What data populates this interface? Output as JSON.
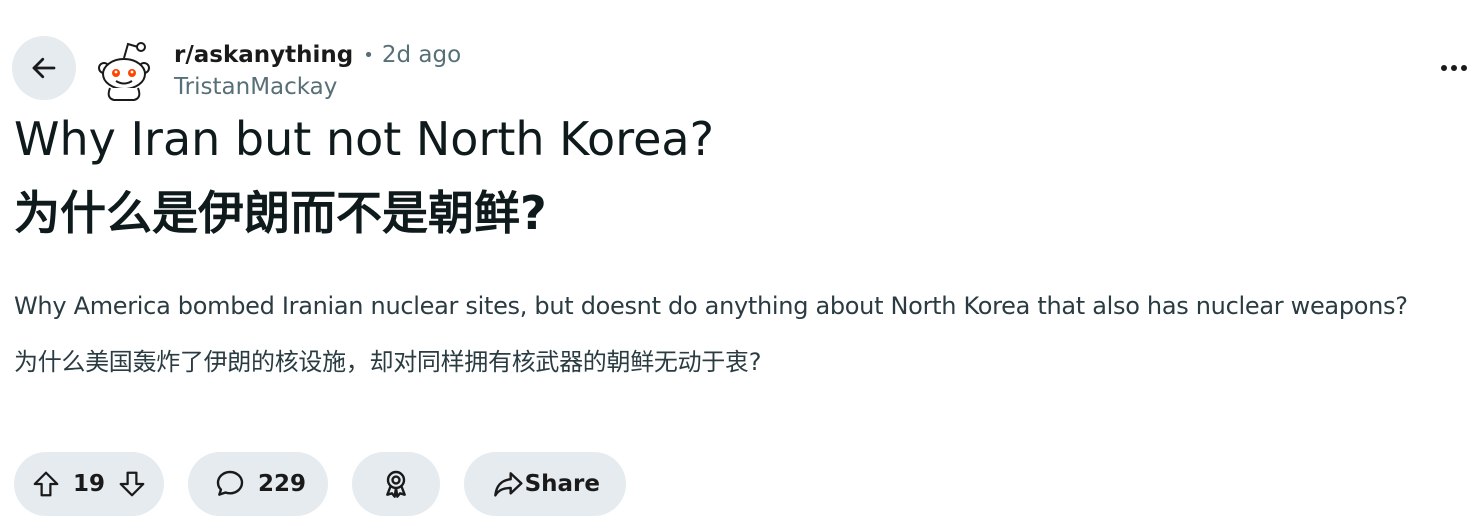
{
  "header": {
    "subreddit": "r/askanything",
    "separator": "•",
    "timestamp": "2d ago",
    "author": "TristanMackay"
  },
  "post": {
    "title_lines": [
      "Why Iran but not North Korea?",
      "为什么是伊朗而不是朝鲜?"
    ],
    "body_lines": [
      "Why America bombed Iranian nuclear sites, but doesnt do anything about North Korea that also has nuclear weapons?",
      "为什么美国轰炸了伊朗的核设施，却对同样拥有核武器的朝鲜无动于衷?"
    ]
  },
  "actions": {
    "vote_count": "19",
    "comment_count": "229",
    "share_label": "Share"
  },
  "icons": {
    "back": "arrow-left-icon",
    "more": "ellipsis-horizontal-icon",
    "upvote": "arrow-up-outline-icon",
    "downvote": "arrow-down-outline-icon",
    "comment": "speech-bubble-icon",
    "award": "award-ribbon-icon",
    "share": "share-arrow-icon"
  },
  "colors": {
    "pill_background": "#e5ebee",
    "text_primary": "#1a1a1b",
    "text_secondary": "#576f76",
    "snoo_eyes": "#ff4500"
  }
}
